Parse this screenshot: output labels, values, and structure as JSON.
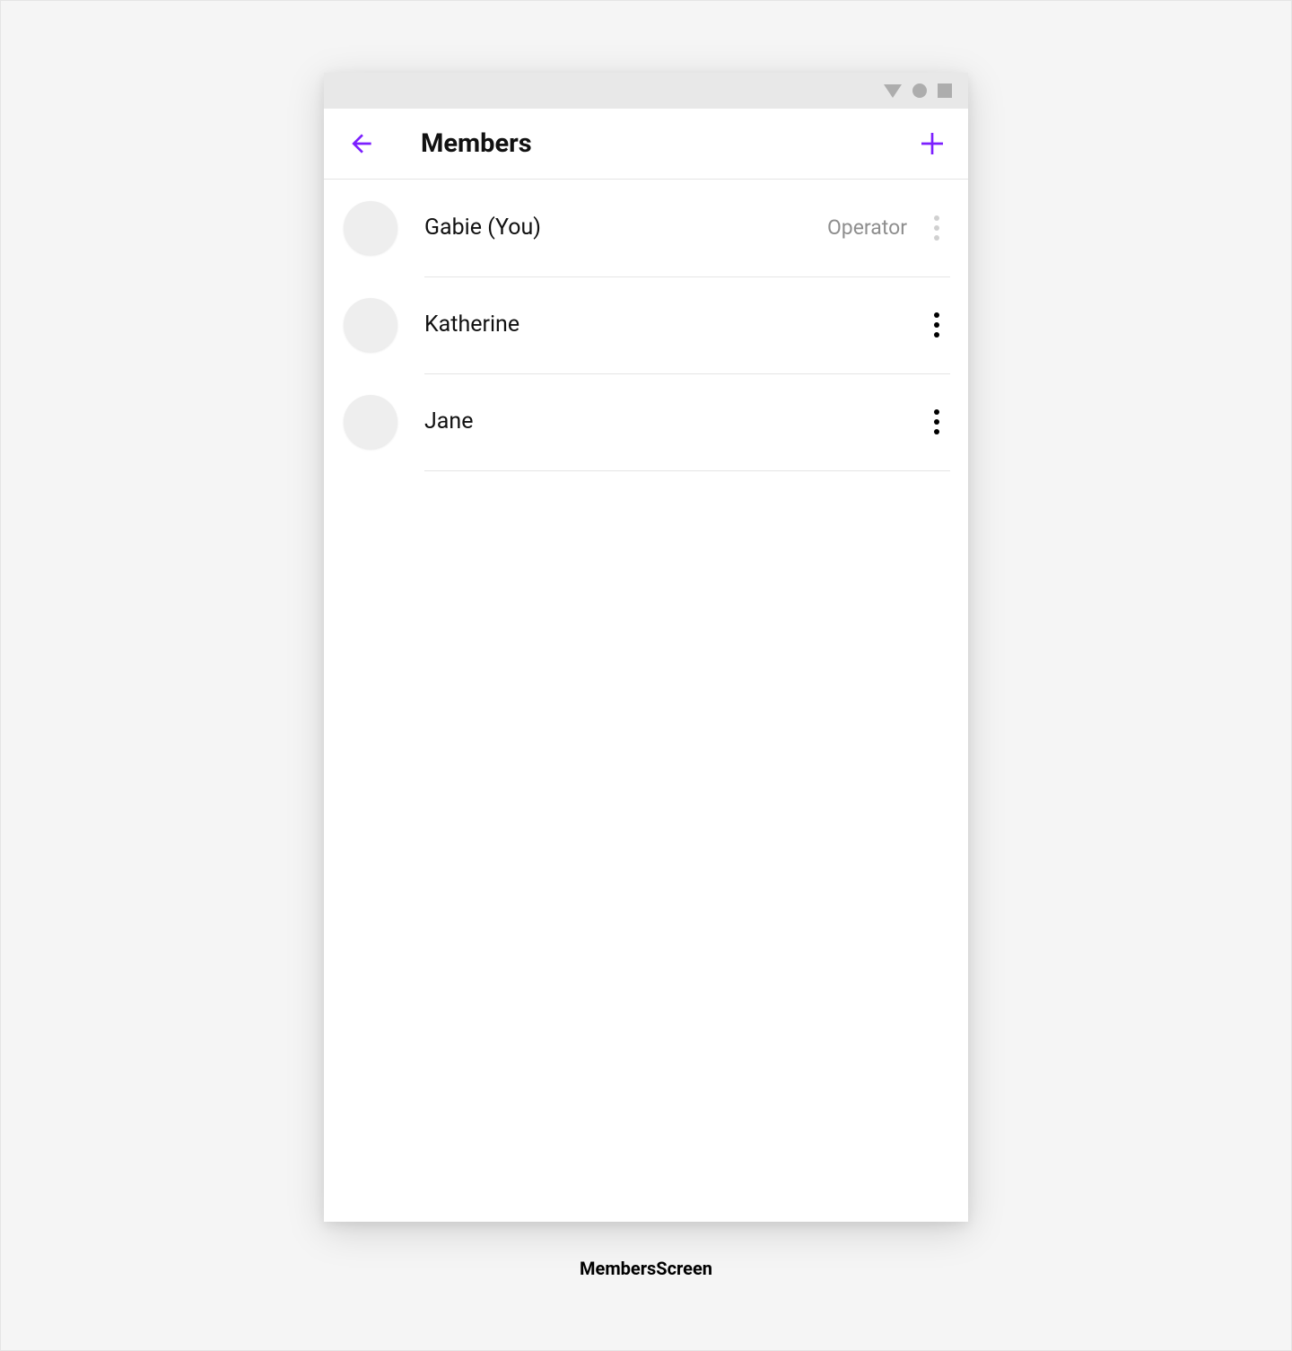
{
  "colors": {
    "accent": "#7c1fff"
  },
  "header": {
    "title": "Members"
  },
  "members": [
    {
      "name": "Gabie (You)",
      "role": "Operator",
      "more_disabled": true,
      "avatar": "av1"
    },
    {
      "name": "Katherine",
      "role": "",
      "more_disabled": false,
      "avatar": "av2"
    },
    {
      "name": "Jane",
      "role": "",
      "more_disabled": false,
      "avatar": "av3"
    }
  ],
  "screen_label": "MembersScreen"
}
